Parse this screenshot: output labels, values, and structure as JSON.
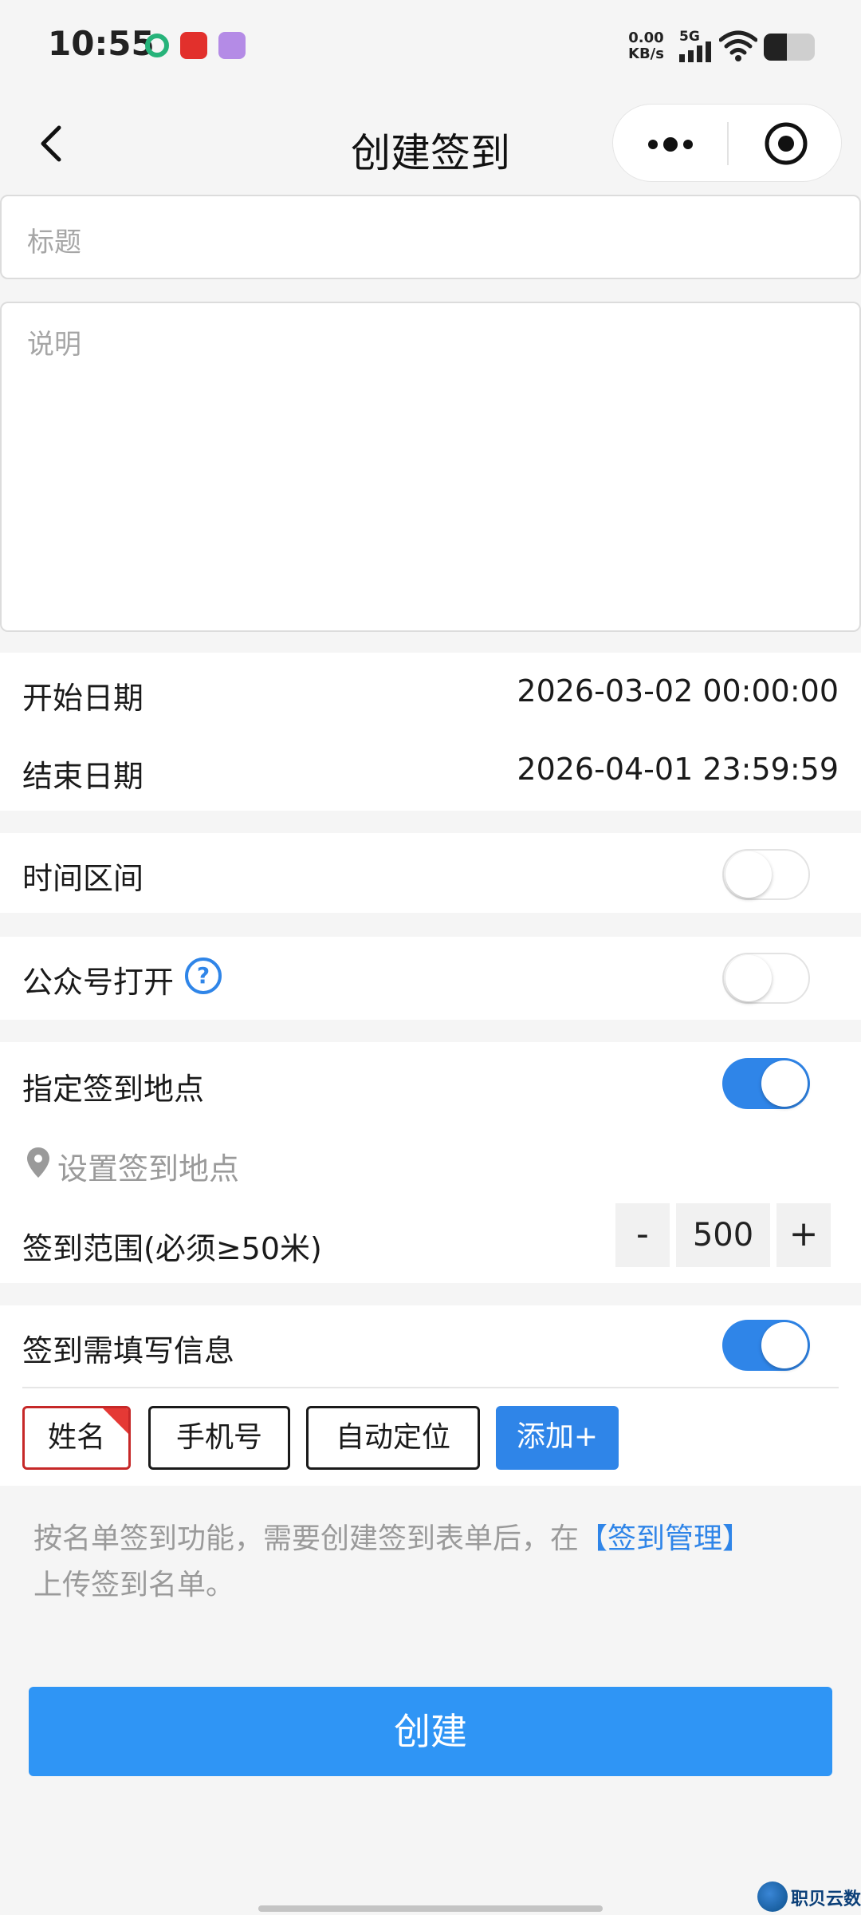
{
  "status_bar": {
    "time": "10:55",
    "net_speed_value": "0.00",
    "net_speed_unit": "KB/s",
    "network": "5G",
    "battery_level": 0.45
  },
  "nav": {
    "title": "创建签到"
  },
  "form": {
    "title_placeholder": "标题",
    "description_placeholder": "说明"
  },
  "dates": {
    "start_label": "开始日期",
    "start_value": "2026-03-02 00:00:00",
    "end_label": "结束日期",
    "end_value": "2026-04-01 23:59:59"
  },
  "toggles": {
    "time_range_label": "时间区间",
    "time_range_on": false,
    "official_account_label": "公众号打开",
    "official_account_on": false,
    "help_glyph": "?",
    "location_label": "指定签到地点",
    "location_on": true,
    "info_label": "签到需填写信息",
    "info_on": true
  },
  "location": {
    "set_location_text": "设置签到地点",
    "range_label": "签到范围(必须≥50米)",
    "minus": "-",
    "range_value": "500",
    "plus": "+"
  },
  "info_fields": {
    "tags": [
      "姓名",
      "手机号",
      "自动定位"
    ],
    "add_label": "添加+"
  },
  "notice": {
    "text_before": "按名单签到功能，需要创建签到表单后，在",
    "link": "【签到管理】",
    "text_after": "上传签到名单。"
  },
  "create_button": "创建",
  "watermark": "职贝云数",
  "colors": {
    "accent": "#2f85e8",
    "button": "#2f95f5",
    "selected_border": "#c62828",
    "selected_corner": "#e53935"
  }
}
